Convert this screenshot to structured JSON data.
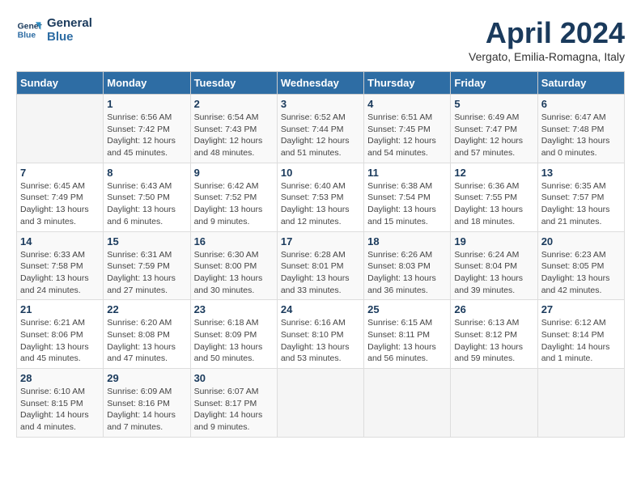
{
  "header": {
    "logo_line1": "General",
    "logo_line2": "Blue",
    "month": "April 2024",
    "location": "Vergato, Emilia-Romagna, Italy"
  },
  "weekdays": [
    "Sunday",
    "Monday",
    "Tuesday",
    "Wednesday",
    "Thursday",
    "Friday",
    "Saturday"
  ],
  "weeks": [
    [
      {
        "day": "",
        "info": ""
      },
      {
        "day": "1",
        "info": "Sunrise: 6:56 AM\nSunset: 7:42 PM\nDaylight: 12 hours\nand 45 minutes."
      },
      {
        "day": "2",
        "info": "Sunrise: 6:54 AM\nSunset: 7:43 PM\nDaylight: 12 hours\nand 48 minutes."
      },
      {
        "day": "3",
        "info": "Sunrise: 6:52 AM\nSunset: 7:44 PM\nDaylight: 12 hours\nand 51 minutes."
      },
      {
        "day": "4",
        "info": "Sunrise: 6:51 AM\nSunset: 7:45 PM\nDaylight: 12 hours\nand 54 minutes."
      },
      {
        "day": "5",
        "info": "Sunrise: 6:49 AM\nSunset: 7:47 PM\nDaylight: 12 hours\nand 57 minutes."
      },
      {
        "day": "6",
        "info": "Sunrise: 6:47 AM\nSunset: 7:48 PM\nDaylight: 13 hours\nand 0 minutes."
      }
    ],
    [
      {
        "day": "7",
        "info": "Sunrise: 6:45 AM\nSunset: 7:49 PM\nDaylight: 13 hours\nand 3 minutes."
      },
      {
        "day": "8",
        "info": "Sunrise: 6:43 AM\nSunset: 7:50 PM\nDaylight: 13 hours\nand 6 minutes."
      },
      {
        "day": "9",
        "info": "Sunrise: 6:42 AM\nSunset: 7:52 PM\nDaylight: 13 hours\nand 9 minutes."
      },
      {
        "day": "10",
        "info": "Sunrise: 6:40 AM\nSunset: 7:53 PM\nDaylight: 13 hours\nand 12 minutes."
      },
      {
        "day": "11",
        "info": "Sunrise: 6:38 AM\nSunset: 7:54 PM\nDaylight: 13 hours\nand 15 minutes."
      },
      {
        "day": "12",
        "info": "Sunrise: 6:36 AM\nSunset: 7:55 PM\nDaylight: 13 hours\nand 18 minutes."
      },
      {
        "day": "13",
        "info": "Sunrise: 6:35 AM\nSunset: 7:57 PM\nDaylight: 13 hours\nand 21 minutes."
      }
    ],
    [
      {
        "day": "14",
        "info": "Sunrise: 6:33 AM\nSunset: 7:58 PM\nDaylight: 13 hours\nand 24 minutes."
      },
      {
        "day": "15",
        "info": "Sunrise: 6:31 AM\nSunset: 7:59 PM\nDaylight: 13 hours\nand 27 minutes."
      },
      {
        "day": "16",
        "info": "Sunrise: 6:30 AM\nSunset: 8:00 PM\nDaylight: 13 hours\nand 30 minutes."
      },
      {
        "day": "17",
        "info": "Sunrise: 6:28 AM\nSunset: 8:01 PM\nDaylight: 13 hours\nand 33 minutes."
      },
      {
        "day": "18",
        "info": "Sunrise: 6:26 AM\nSunset: 8:03 PM\nDaylight: 13 hours\nand 36 minutes."
      },
      {
        "day": "19",
        "info": "Sunrise: 6:24 AM\nSunset: 8:04 PM\nDaylight: 13 hours\nand 39 minutes."
      },
      {
        "day": "20",
        "info": "Sunrise: 6:23 AM\nSunset: 8:05 PM\nDaylight: 13 hours\nand 42 minutes."
      }
    ],
    [
      {
        "day": "21",
        "info": "Sunrise: 6:21 AM\nSunset: 8:06 PM\nDaylight: 13 hours\nand 45 minutes."
      },
      {
        "day": "22",
        "info": "Sunrise: 6:20 AM\nSunset: 8:08 PM\nDaylight: 13 hours\nand 47 minutes."
      },
      {
        "day": "23",
        "info": "Sunrise: 6:18 AM\nSunset: 8:09 PM\nDaylight: 13 hours\nand 50 minutes."
      },
      {
        "day": "24",
        "info": "Sunrise: 6:16 AM\nSunset: 8:10 PM\nDaylight: 13 hours\nand 53 minutes."
      },
      {
        "day": "25",
        "info": "Sunrise: 6:15 AM\nSunset: 8:11 PM\nDaylight: 13 hours\nand 56 minutes."
      },
      {
        "day": "26",
        "info": "Sunrise: 6:13 AM\nSunset: 8:12 PM\nDaylight: 13 hours\nand 59 minutes."
      },
      {
        "day": "27",
        "info": "Sunrise: 6:12 AM\nSunset: 8:14 PM\nDaylight: 14 hours\nand 1 minute."
      }
    ],
    [
      {
        "day": "28",
        "info": "Sunrise: 6:10 AM\nSunset: 8:15 PM\nDaylight: 14 hours\nand 4 minutes."
      },
      {
        "day": "29",
        "info": "Sunrise: 6:09 AM\nSunset: 8:16 PM\nDaylight: 14 hours\nand 7 minutes."
      },
      {
        "day": "30",
        "info": "Sunrise: 6:07 AM\nSunset: 8:17 PM\nDaylight: 14 hours\nand 9 minutes."
      },
      {
        "day": "",
        "info": ""
      },
      {
        "day": "",
        "info": ""
      },
      {
        "day": "",
        "info": ""
      },
      {
        "day": "",
        "info": ""
      }
    ]
  ]
}
